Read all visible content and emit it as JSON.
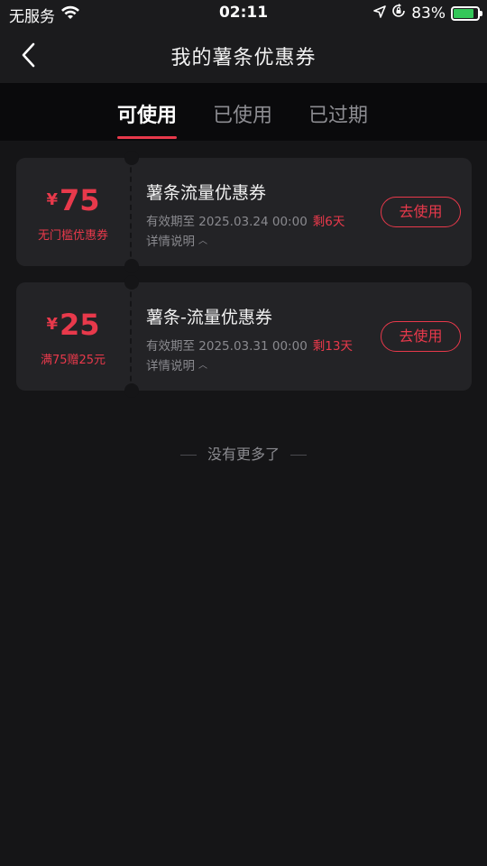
{
  "statusbar": {
    "carrier": "无服务",
    "time": "02:11",
    "battery": "83%",
    "battery_level": 0.83,
    "wifi_icon": "wifi-icon",
    "location_icon": "location-arrow-icon",
    "lock_icon": "orientation-lock-icon"
  },
  "header": {
    "title": "我的薯条优惠券",
    "back_icon": "chevron-left-icon"
  },
  "tabs": [
    {
      "label": "可使用",
      "active": true
    },
    {
      "label": "已使用",
      "active": false
    },
    {
      "label": "已过期",
      "active": false
    }
  ],
  "coupons": [
    {
      "currency": "¥",
      "amount": "75",
      "condition": "无门槛优惠券",
      "title": "薯条流量优惠券",
      "valid": "有效期至 2025.03.24 00:00",
      "remain": "剩6天",
      "detail": "详情说明",
      "button": "去使用"
    },
    {
      "currency": "¥",
      "amount": "25",
      "condition": "满75赠25元",
      "title": "薯条-流量优惠券",
      "valid": "有效期至 2025.03.31 00:00",
      "remain": "剩13天",
      "detail": "详情说明",
      "button": "去使用"
    }
  ],
  "footer": {
    "no_more": "没有更多了"
  },
  "colors": {
    "accent": "#e8394b",
    "background": "#151517",
    "card": "#232326",
    "battery": "#34c759"
  }
}
